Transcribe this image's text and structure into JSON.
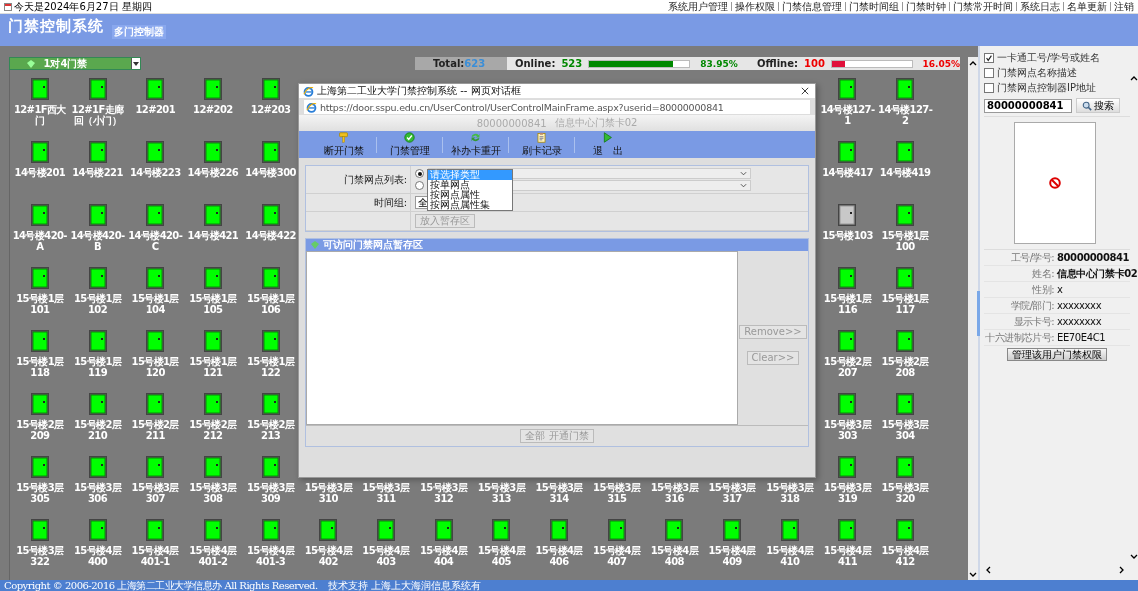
{
  "top_bar": {
    "date": "今天是2024年6月27日 星期四",
    "menu": [
      "系统用户管理",
      "操作权限",
      "门禁信息管理",
      "门禁时间组",
      "门禁时钟",
      "门禁常开时间",
      "系统日志",
      "名单更新",
      "注销"
    ]
  },
  "header": {
    "title": "门禁控制系统",
    "subtitle": "多门控制器"
  },
  "status_bar": {
    "controller_type": "1对4门禁",
    "total_label": "Total:",
    "total_value": "623",
    "online_label": "Online:",
    "online_value": "523",
    "online": {
      "level": 0.8395,
      "reading": "83.95%"
    },
    "offline_label": "Offline:",
    "offline_value": "100",
    "offline": {
      "level": 0.1605,
      "reading": "16.05%"
    }
  },
  "door_grid": {
    "rows": [
      {
        "left": [
          {
            "kind": "door",
            "label": "12#1F西大门",
            "online": true
          },
          {
            "kind": "door",
            "label": "12#1F走廊回（小门）",
            "online": true
          },
          {
            "kind": "door",
            "label": "12#201",
            "online": true
          },
          {
            "kind": "door",
            "label": "12#202",
            "online": true
          },
          {
            "kind": "door",
            "label": "12#203",
            "online": true
          }
        ],
        "right": [
          {
            "kind": "door",
            "label": "14号楼127-1",
            "online": true
          },
          {
            "kind": "door",
            "label": "14号楼127-2",
            "online": true
          }
        ]
      },
      {
        "left": [
          {
            "kind": "door",
            "label": "14号楼201",
            "online": true
          },
          {
            "kind": "door",
            "label": "14号楼221",
            "online": true
          },
          {
            "kind": "door",
            "label": "14号楼223",
            "online": true
          },
          {
            "kind": "door",
            "label": "14号楼226",
            "online": true
          },
          {
            "kind": "door",
            "label": "14号楼300",
            "online": true
          }
        ],
        "right": [
          {
            "kind": "door",
            "label": "14号楼417",
            "online": true
          },
          {
            "kind": "door",
            "label": "14号楼419",
            "online": true
          }
        ]
      },
      {
        "left": [
          {
            "kind": "door",
            "label": "14号楼420-A",
            "online": true
          },
          {
            "kind": "door",
            "label": "14号楼420-B",
            "online": true
          },
          {
            "kind": "door",
            "label": "14号楼420-C",
            "online": true
          },
          {
            "kind": "door",
            "label": "14号楼421",
            "online": true
          },
          {
            "kind": "door",
            "label": "14号楼422",
            "online": true
          }
        ],
        "right": [
          {
            "kind": "door",
            "label": "15号楼103",
            "online": false
          },
          {
            "kind": "door",
            "label": "15号楼1层100",
            "online": true
          }
        ]
      },
      {
        "left": [
          {
            "kind": "door",
            "label": "15号楼1层101",
            "online": true
          },
          {
            "kind": "door",
            "label": "15号楼1层102",
            "online": true
          },
          {
            "kind": "door",
            "label": "15号楼1层104",
            "online": true
          },
          {
            "kind": "door",
            "label": "15号楼1层105",
            "online": true
          },
          {
            "kind": "door",
            "label": "15号楼1层106",
            "online": true
          }
        ],
        "right": [
          {
            "kind": "door",
            "label": "15号楼1层116",
            "online": true
          },
          {
            "kind": "door",
            "label": "15号楼1层117",
            "online": true
          }
        ]
      },
      {
        "left": [
          {
            "kind": "door",
            "label": "15号楼1层118",
            "online": true
          },
          {
            "kind": "door",
            "label": "15号楼1层119",
            "online": true
          },
          {
            "kind": "door",
            "label": "15号楼1层120",
            "online": true
          },
          {
            "kind": "door",
            "label": "15号楼1层121",
            "online": true
          },
          {
            "kind": "door",
            "label": "15号楼1层122",
            "online": true
          }
        ],
        "right": [
          {
            "kind": "door",
            "label": "15号楼2层207",
            "online": true
          },
          {
            "kind": "door",
            "label": "15号楼2层208",
            "online": true
          }
        ]
      },
      {
        "left": [
          {
            "kind": "door",
            "label": "15号楼2层209",
            "online": true
          },
          {
            "kind": "door",
            "label": "15号楼2层210",
            "online": true
          },
          {
            "kind": "door",
            "label": "15号楼2层211",
            "online": true
          },
          {
            "kind": "door",
            "label": "15号楼2层212",
            "online": true
          },
          {
            "kind": "door",
            "label": "15号楼2层213",
            "online": true
          }
        ],
        "right": [
          {
            "kind": "door",
            "label": "15号楼3层303",
            "online": true
          },
          {
            "kind": "door",
            "label": "15号楼3层304",
            "online": true
          }
        ]
      },
      {
        "left": [
          {
            "kind": "door",
            "label": "15号楼3层305",
            "online": true
          },
          {
            "kind": "door",
            "label": "15号楼3层306",
            "online": true
          },
          {
            "kind": "door",
            "label": "15号楼3层307",
            "online": true
          },
          {
            "kind": "door",
            "label": "15号楼3层308",
            "online": true
          },
          {
            "kind": "door",
            "label": "15号楼3层309",
            "online": true
          }
        ],
        "middle": [
          {
            "kind": "label",
            "label": "15号楼3层310"
          },
          {
            "kind": "label",
            "label": "15号楼3层311"
          },
          {
            "kind": "label",
            "label": "15号楼3层312"
          },
          {
            "kind": "label",
            "label": "15号楼3层313"
          },
          {
            "kind": "label",
            "label": "15号楼3层314"
          },
          {
            "kind": "label",
            "label": "15号楼3层315"
          },
          {
            "kind": "label",
            "label": "15号楼3层316"
          },
          {
            "kind": "label",
            "label": "15号楼3层317"
          },
          {
            "kind": "label",
            "label": "15号楼3层318"
          }
        ],
        "right": [
          {
            "kind": "door",
            "label": "15号楼3层319",
            "online": true
          },
          {
            "kind": "door",
            "label": "15号楼3层320",
            "online": true
          }
        ]
      },
      {
        "left": [
          {
            "kind": "door",
            "label": "15号楼3层322",
            "online": true
          },
          {
            "kind": "door",
            "label": "15号楼4层400",
            "online": true
          },
          {
            "kind": "door",
            "label": "15号楼4层401-1",
            "online": true
          },
          {
            "kind": "door",
            "label": "15号楼4层401-2",
            "online": true
          },
          {
            "kind": "door",
            "label": "15号楼4层401-3",
            "online": true
          },
          {
            "kind": "door",
            "label": "15号楼4层402",
            "online": true
          },
          {
            "kind": "door",
            "label": "15号楼4层403",
            "online": true
          },
          {
            "kind": "door",
            "label": "15号楼4层404",
            "online": true
          },
          {
            "kind": "door",
            "label": "15号楼4层405",
            "online": true
          },
          {
            "kind": "door",
            "label": "15号楼4层406",
            "online": true
          },
          {
            "kind": "door",
            "label": "15号楼4层407",
            "online": true
          },
          {
            "kind": "door",
            "label": "15号楼4层408",
            "online": true
          },
          {
            "kind": "door",
            "label": "15号楼4层409",
            "online": true
          },
          {
            "kind": "door",
            "label": "15号楼4层410",
            "online": true
          },
          {
            "kind": "door",
            "label": "15号楼4层411",
            "online": true
          },
          {
            "kind": "door",
            "label": "15号楼4层412",
            "online": true
          }
        ]
      }
    ]
  },
  "dialog": {
    "title": "上海第二工业大学门禁控制系统 -- 网页对话框",
    "url": "https://door.sspu.edu.cn/UserControl/UserControlMainFrame.aspx?userid=80000000841",
    "user_id": "80000000841",
    "user_name": "信息中心门禁卡02",
    "toolbar": [
      {
        "kind": "key",
        "label": "断开门禁"
      },
      {
        "kind": "check",
        "label": "门禁管理"
      },
      {
        "kind": "refresh",
        "label": "补办卡重开"
      },
      {
        "kind": "clipboard",
        "label": "刷卡记录"
      },
      {
        "kind": "exit",
        "label": "退　出"
      }
    ],
    "site_list_label": "门禁网点列表:",
    "radios": [
      {
        "selected": true
      },
      {
        "selected": false
      }
    ],
    "type_options": [
      {
        "label": "请选择类型",
        "selected": true
      },
      {
        "label": "按单网点",
        "selected": false
      },
      {
        "label": "按网点属性",
        "selected": false
      },
      {
        "label": "按网点属性集",
        "selected": false
      }
    ],
    "time_group_label": "时间组:",
    "time_group_value": "全",
    "add_button": "放入暂存区",
    "staging_title": "可访问门禁网点暂存区",
    "remove_button": "Remove>>",
    "clear_button": "Clear>>",
    "open_all_button": "全部 开通门禁"
  },
  "side_panel": {
    "filters": [
      {
        "label": "一卡通工号/学号或姓名",
        "checked": true
      },
      {
        "label": "门禁网点名称描述",
        "checked": false
      },
      {
        "label": "门禁网点控制器IP地址",
        "checked": false
      }
    ],
    "search_value": "80000000841",
    "search_button": "搜索",
    "details": [
      {
        "label": "工号/学号:",
        "value": "80000000841"
      },
      {
        "label": "姓名:",
        "value": "信息中心门禁卡02"
      },
      {
        "label": "性别:",
        "value": "x"
      },
      {
        "label": "学院/部门:",
        "value": "xxxxxxxx"
      },
      {
        "label": "显示卡号:",
        "value": "xxxxxxxx"
      },
      {
        "label": "十六进制芯片号:",
        "value": "EE70E4C1"
      }
    ],
    "manage_button": "管理该用户门禁权限"
  },
  "footer": {
    "copyright": "Copyright © 2006-2016  上海第二工业大学信息办 All Rights Reserved.",
    "support": "技术支持 上海上大海润信息系统有"
  }
}
